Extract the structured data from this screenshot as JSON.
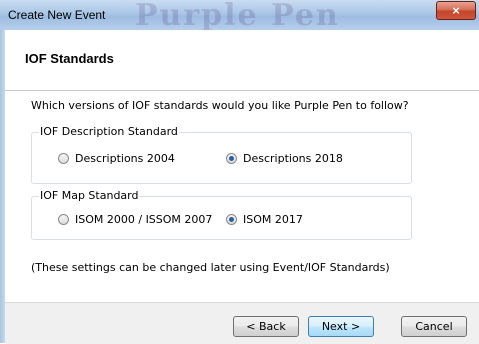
{
  "window": {
    "title": "Create New Event",
    "watermark": "Purple Pen",
    "close_glyph": "×"
  },
  "header": {
    "title": "IOF Standards"
  },
  "body": {
    "question": "Which versions of IOF standards would you like Purple Pen to follow?",
    "description_group": {
      "legend": "IOF Description Standard",
      "options": [
        {
          "label": "Descriptions 2004",
          "checked": false
        },
        {
          "label": "Descriptions 2018",
          "checked": true
        }
      ]
    },
    "map_group": {
      "legend": "IOF Map Standard",
      "options": [
        {
          "label": "ISOM 2000 / ISSOM 2007",
          "checked": false
        },
        {
          "label": "ISOM 2017",
          "checked": true
        }
      ]
    },
    "note": "(These settings can be changed later using Event/IOF Standards)"
  },
  "footer": {
    "back_label": "< Back",
    "next_label": "Next >",
    "cancel_label": "Cancel"
  }
}
